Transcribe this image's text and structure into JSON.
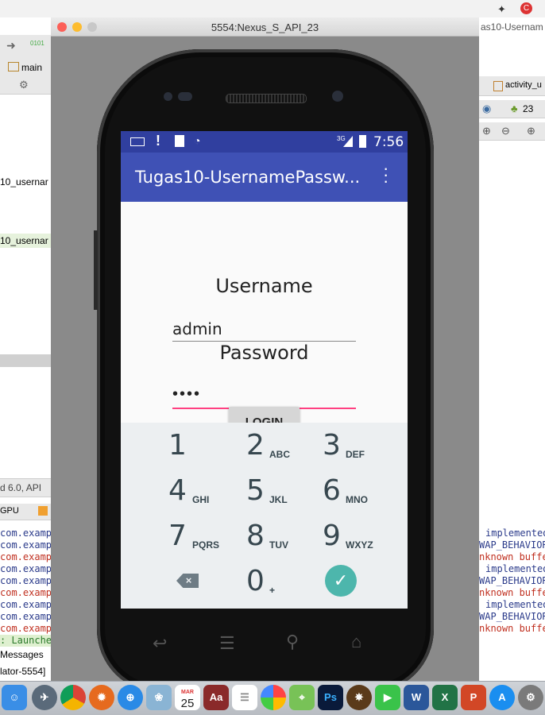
{
  "emulator": {
    "window_title": "5554:Nexus_S_API_23",
    "right_title": "as10-Usernam"
  },
  "ide": {
    "branch": "main",
    "left_texts": [
      "10_usernar",
      "10_usernar",
      "d 6.0, API",
      "GPU",
      "Messages",
      "lator-5554]"
    ],
    "left_log": [
      "com.exampl",
      "com.exampl",
      "com.exampl",
      "com.exampl",
      "com.exampl",
      "com.exampl",
      "com.exampl",
      "com.exampl",
      "com.exampl"
    ],
    "launched": ": Launched c",
    "right_tab": "activity_u",
    "api_level": "23",
    "right_log": [
      "implemented",
      "WAP_BEHAVIOR",
      "nknown buffe",
      "implemented",
      "WAP_BEHAVIOR",
      "nknown buffe",
      "implemented",
      "WAP_BEHAVIOR",
      "nknown buffe"
    ]
  },
  "status_bar": {
    "network": "3G",
    "time": "7:56"
  },
  "app": {
    "title": "Tugas10-UsernamePassw...",
    "username_label": "Username",
    "username_value": "admin",
    "password_label": "Password",
    "password_value": "••••",
    "login_button": "LOGIN"
  },
  "keypad": {
    "keys": [
      {
        "num": "1",
        "sub": ""
      },
      {
        "num": "2",
        "sub": "ABC"
      },
      {
        "num": "3",
        "sub": "DEF"
      },
      {
        "num": "4",
        "sub": "GHI"
      },
      {
        "num": "5",
        "sub": "JKL"
      },
      {
        "num": "6",
        "sub": "MNO"
      },
      {
        "num": "7",
        "sub": "PQRS"
      },
      {
        "num": "8",
        "sub": "TUV"
      },
      {
        "num": "9",
        "sub": "WXYZ"
      }
    ],
    "zero": "0",
    "zero_sub": "+"
  },
  "dock": {
    "calendar_month": "MAR",
    "calendar_day": "25"
  },
  "colors": {
    "primary": "#3f51b5",
    "primary_dark": "#303f9f",
    "accent": "#ff4081",
    "confirm": "#4db6ac"
  }
}
